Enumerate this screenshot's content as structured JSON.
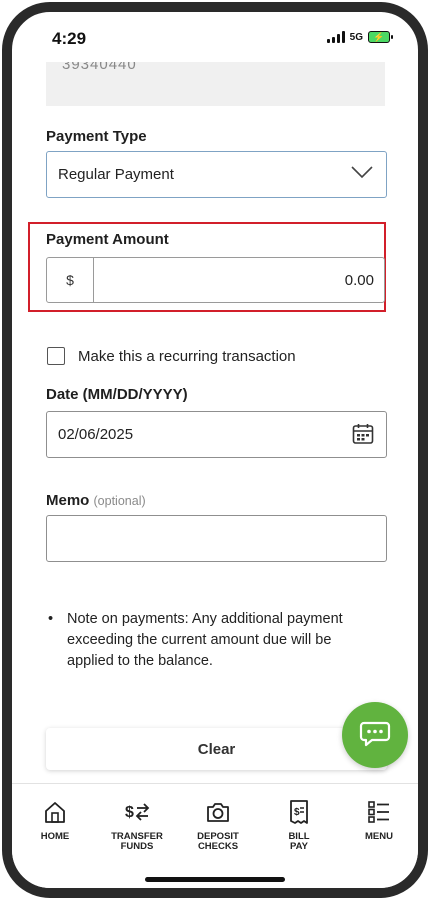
{
  "status_bar": {
    "time": "4:29",
    "network": "5G"
  },
  "account": {
    "partial_number": "39340440"
  },
  "payment_type": {
    "label": "Payment Type",
    "value": "Regular Payment"
  },
  "payment_amount": {
    "label": "Payment Amount",
    "currency": "$",
    "value": "0.00",
    "highlight_color": "#d21f2a"
  },
  "recurring": {
    "label": "Make this a recurring transaction",
    "checked": false
  },
  "date": {
    "label": "Date (MM/DD/YYYY)",
    "value": "02/06/2025"
  },
  "memo": {
    "label": "Memo",
    "optional": "(optional)",
    "value": ""
  },
  "note": {
    "bullet": "•",
    "text": "Note on payments: Any additional payment exceeding the current amount due will be applied to the balance."
  },
  "clear_button": {
    "label": "Clear"
  },
  "chat": {
    "color": "#61b33f",
    "icon": "chat-bubble-icon"
  },
  "tabs": [
    {
      "label": "HOME",
      "icon": "home-icon"
    },
    {
      "label": "TRANSFER FUNDS",
      "icon": "transfer-icon"
    },
    {
      "label": "DEPOSIT CHECKS",
      "icon": "camera-icon"
    },
    {
      "label": "BILL PAY",
      "icon": "bill-icon"
    },
    {
      "label": "MENU",
      "icon": "menu-list-icon"
    }
  ]
}
